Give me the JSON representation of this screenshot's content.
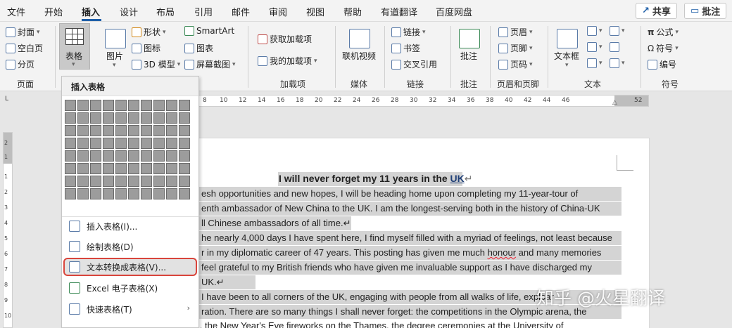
{
  "menu_tabs": [
    "文件",
    "开始",
    "插入",
    "设计",
    "布局",
    "引用",
    "邮件",
    "审阅",
    "视图",
    "帮助",
    "有道翻译",
    "百度网盘"
  ],
  "active_tab": "插入",
  "top_buttons": {
    "share": "共享",
    "comment": "批注"
  },
  "ribbon": {
    "pages": {
      "cover": "封面",
      "blank": "空白页",
      "break": "分页",
      "group": "页面"
    },
    "tables": {
      "table": "表格"
    },
    "illustrations": {
      "picture": "图片",
      "shapes": "形状",
      "icons": "图标",
      "models": "3D 模型",
      "smartart": "SmartArt",
      "chart": "图表",
      "screenshot": "屏幕截图"
    },
    "addins": {
      "get": "获取加载项",
      "mine": "我的加载项",
      "group": "加载项"
    },
    "media": {
      "video": "联机视频",
      "group": "媒体"
    },
    "links": {
      "link": "链接",
      "bookmark": "书签",
      "crossref": "交叉引用",
      "group": "链接"
    },
    "comments": {
      "comment": "批注",
      "group": "批注"
    },
    "header_footer": {
      "header": "页眉",
      "footer": "页脚",
      "page_number": "页码",
      "group": "页眉和页脚"
    },
    "text": {
      "textbox": "文本框",
      "group": "文本"
    },
    "symbols": {
      "equation": "公式",
      "symbol": "符号",
      "numbering": "编号",
      "group": "符号"
    }
  },
  "ruler": {
    "h_numbers": [
      "8",
      "10",
      "12",
      "14",
      "16",
      "18",
      "20",
      "22",
      "24",
      "26",
      "28",
      "30",
      "32",
      "34",
      "36",
      "38",
      "40",
      "42",
      "44",
      "46",
      "52"
    ],
    "v_numbers": [
      "2",
      "1",
      "1",
      "2",
      "3",
      "4",
      "5",
      "6",
      "7",
      "8",
      "9",
      "10"
    ]
  },
  "dropdown": {
    "header": "插入表格",
    "grid_rows": 8,
    "grid_cols": 10,
    "items": [
      {
        "label": "插入表格(I)...",
        "icon": "insert-table-icon"
      },
      {
        "label": "绘制表格(D)",
        "icon": "draw-table-icon"
      },
      {
        "label": "文本转换成表格(V)...",
        "icon": "text-to-table-icon",
        "highlighted": true
      },
      {
        "label": "Excel 电子表格(X)",
        "icon": "excel-icon"
      },
      {
        "label": "快速表格(T)",
        "icon": "quick-table-icon",
        "submenu": true
      }
    ]
  },
  "document": {
    "title_a": "I will never forget my 11 years in the ",
    "title_b": "UK",
    "title_mark": "↵",
    "lines": [
      "esh opportunities and new hopes, I will be heading home upon completing my 11-year-tour of",
      "enth ambassador of New China to the UK. I am the longest-serving both in the history of China-UK",
      "ll Chinese ambassadors of all time.↵",
      "he nearly 4,000 days I have spent here, I find myself filled with a myriad of feelings, not least because",
      "r in my diplomatic career of 47 years. This posting has given me much ",
      "feel grateful to my British friends who have given me invaluable support as I have discharged my",
      "UK.↵",
      "I have been to all corners of the UK, engaging with people from all walks of life, explo",
      "ration. There are so many things I shall never forget: the competitions in the Olympic arena, the",
      "chimes of Big Ben, the New Year's Eve fireworks on the Thames, the degree ceremonies at the University of"
    ],
    "honour": "honour",
    "line4_tail": " and many memories",
    "line7_tail": "ar"
  },
  "watermark": "知乎 @火星翻译"
}
